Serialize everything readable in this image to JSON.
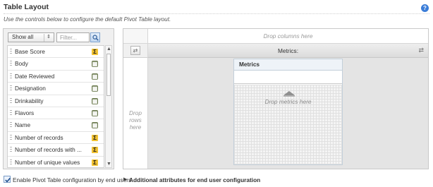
{
  "header": {
    "title": "Table Layout",
    "help_icon": "help-icon",
    "description": "Use the controls below to configure the default Pivot Table layout."
  },
  "attribute_panel": {
    "show_select": {
      "value": "Show all",
      "options": [
        "Show all"
      ]
    },
    "filter": {
      "placeholder": "Filter...",
      "value": ""
    },
    "search_icon": "search-icon",
    "items": [
      {
        "label": "Base Score",
        "kind": "metric",
        "icon": "sigma-icon",
        "glyph": "Σ"
      },
      {
        "label": "Body",
        "kind": "attribute",
        "icon": "attribute-icon",
        "glyph": "▦"
      },
      {
        "label": "Date Reviewed",
        "kind": "attribute",
        "icon": "attribute-icon",
        "glyph": "▦"
      },
      {
        "label": "Designation",
        "kind": "attribute",
        "icon": "attribute-icon",
        "glyph": "▦"
      },
      {
        "label": "Drinkability",
        "kind": "attribute",
        "icon": "attribute-icon",
        "glyph": "▦"
      },
      {
        "label": "Flavors",
        "kind": "attribute",
        "icon": "attribute-icon",
        "glyph": "▦"
      },
      {
        "label": "Name",
        "kind": "attribute",
        "icon": "attribute-icon",
        "glyph": "▦"
      },
      {
        "label": "Number of records",
        "kind": "metric",
        "icon": "sigma-icon",
        "glyph": "Σ"
      },
      {
        "label": "Number of records with ...",
        "kind": "metric",
        "icon": "sigma-icon",
        "glyph": "Σ"
      },
      {
        "label": "Number of unique values",
        "kind": "metric",
        "icon": "sigma-icon",
        "glyph": "Σ"
      }
    ]
  },
  "pivot": {
    "drop_columns": "Drop columns here",
    "metrics_bar_label": "Metrics:",
    "drop_rows": "Drop rows here",
    "metrics_box_title": "Metrics",
    "drop_metrics": "Drop metrics here"
  },
  "footer": {
    "enable_checked": true,
    "enable_label": "Enable Pivot Table configuration by end users",
    "additional_link": "Additional attributes for end user configuration"
  }
}
